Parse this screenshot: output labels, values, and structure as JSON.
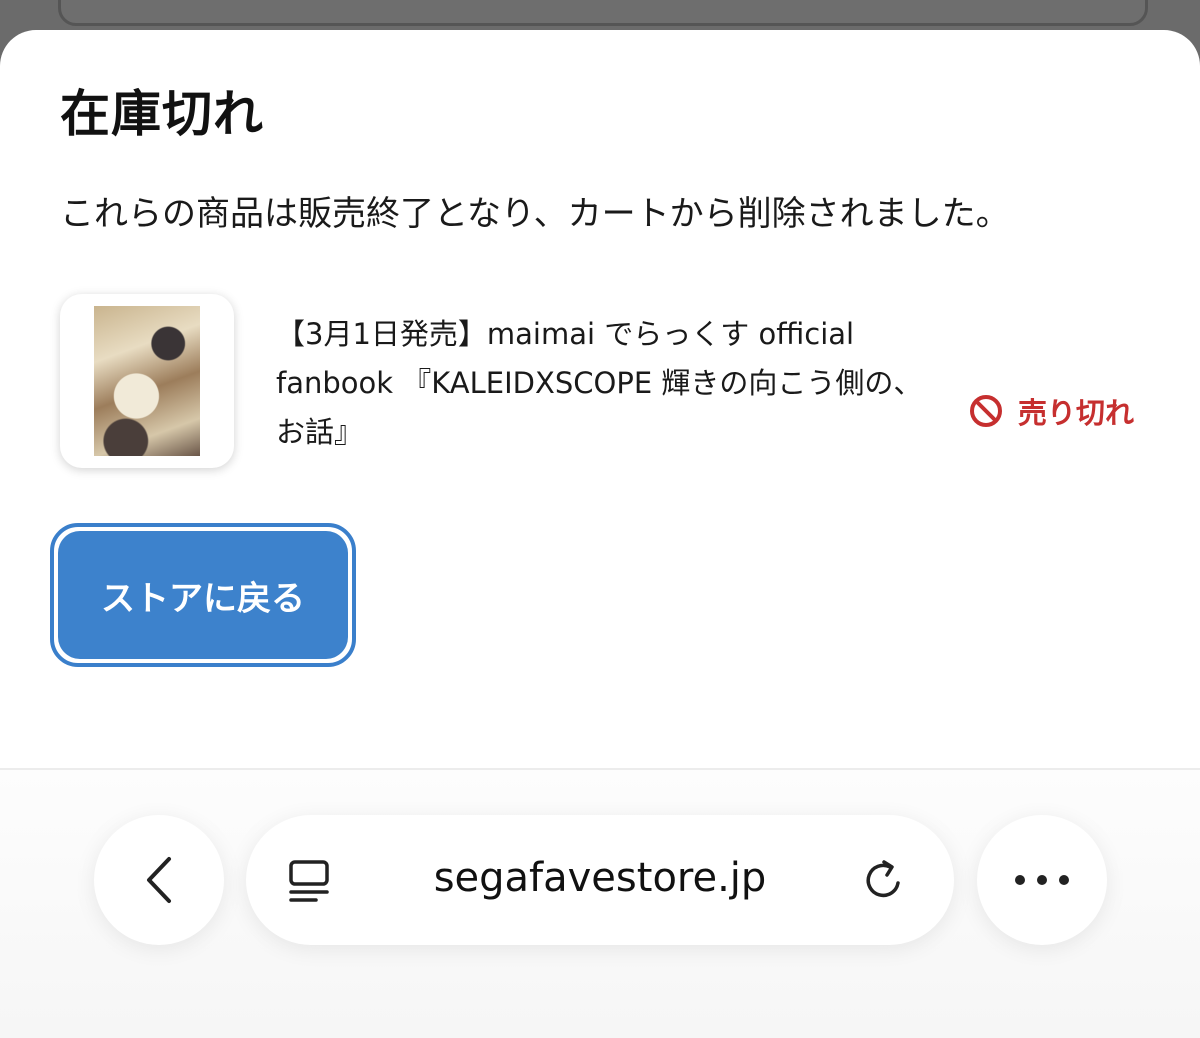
{
  "dialog": {
    "title": "在庫切れ",
    "message": "これらの商品は販売終了となり、カートから削除されました。"
  },
  "item": {
    "name": "【3月1日発売】maimai でらっくす official fanbook 『KALEIDXSCOPE 輝きの向こう側の、お話』",
    "status": "売り切れ",
    "status_icon": "ban-icon"
  },
  "actions": {
    "back_to_store": "ストアに戻る"
  },
  "browser": {
    "url": "segafavestore.jp",
    "icons": [
      "back-chevron-icon",
      "reader-icon",
      "reload-icon",
      "more-icon"
    ]
  },
  "colors": {
    "accent": "#3d82cc",
    "soldout": "#c62f2f"
  }
}
